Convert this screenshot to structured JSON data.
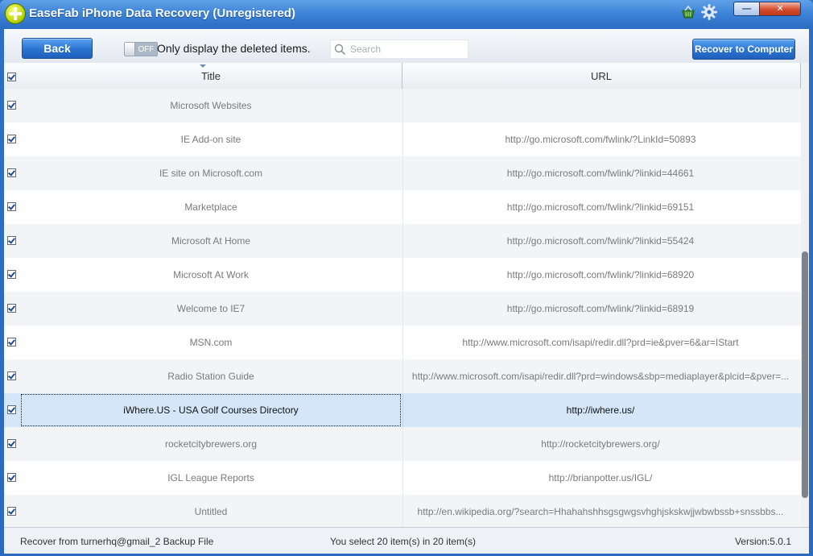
{
  "window": {
    "title": "EaseFab iPhone Data Recovery (Unregistered)",
    "minimize_label": "—",
    "close_label": "✕"
  },
  "toolbar": {
    "back_label": "Back",
    "toggle_state": "OFF",
    "toggle_label": "Only display the deleted items.",
    "search_placeholder": "Search",
    "search_value": "",
    "recover_label": "Recover to Computer"
  },
  "table": {
    "columns": [
      "Title",
      "URL"
    ],
    "rows": [
      {
        "title": "Microsoft Websites",
        "url": ""
      },
      {
        "title": "IE Add-on site",
        "url": "http://go.microsoft.com/fwlink/?LinkId=50893"
      },
      {
        "title": "IE site on Microsoft.com",
        "url": "http://go.microsoft.com/fwlink/?linkid=44661"
      },
      {
        "title": "Marketplace",
        "url": "http://go.microsoft.com/fwlink/?linkid=69151"
      },
      {
        "title": "Microsoft At Home",
        "url": "http://go.microsoft.com/fwlink/?linkid=55424"
      },
      {
        "title": "Microsoft At Work",
        "url": "http://go.microsoft.com/fwlink/?linkid=68920"
      },
      {
        "title": "Welcome to IE7",
        "url": "http://go.microsoft.com/fwlink/?linkid=68919"
      },
      {
        "title": "MSN.com",
        "url": "http://www.microsoft.com/isapi/redir.dll?prd=ie&pver=6&ar=IStart"
      },
      {
        "title": "Radio Station Guide",
        "url": "http://www.microsoft.com/isapi/redir.dll?prd=windows&sbp=mediaplayer&plcid=&pver=..."
      },
      {
        "title": "iWhere.US - USA Golf Courses Directory",
        "url": "http://iwhere.us/"
      },
      {
        "title": "rocketcitybrewers.org",
        "url": "http://rocketcitybrewers.org/"
      },
      {
        "title": "IGL League Reports",
        "url": "http://brianpotter.us/IGL/"
      },
      {
        "title": "Untitled",
        "url": "http://en.wikipedia.org/?search=Hhahahshhsgsgwgsvhghjskskwjjwbwbssb+snssbbs..."
      }
    ],
    "selected_index": 9
  },
  "status": {
    "source": "Recover from turnerhq@gmail_2 Backup File",
    "selection": "You select 20 item(s) in 20 item(s)",
    "version": "Version:5.0.1"
  },
  "colors": {
    "titlebar": "#3b82d6",
    "button_blue": "#2b73d0",
    "selected_row": "#d5e6f8"
  },
  "icons": [
    "app-logo-icon",
    "store-icon",
    "settings-gear-icon",
    "search-icon",
    "checkbox-checked-icon"
  ]
}
